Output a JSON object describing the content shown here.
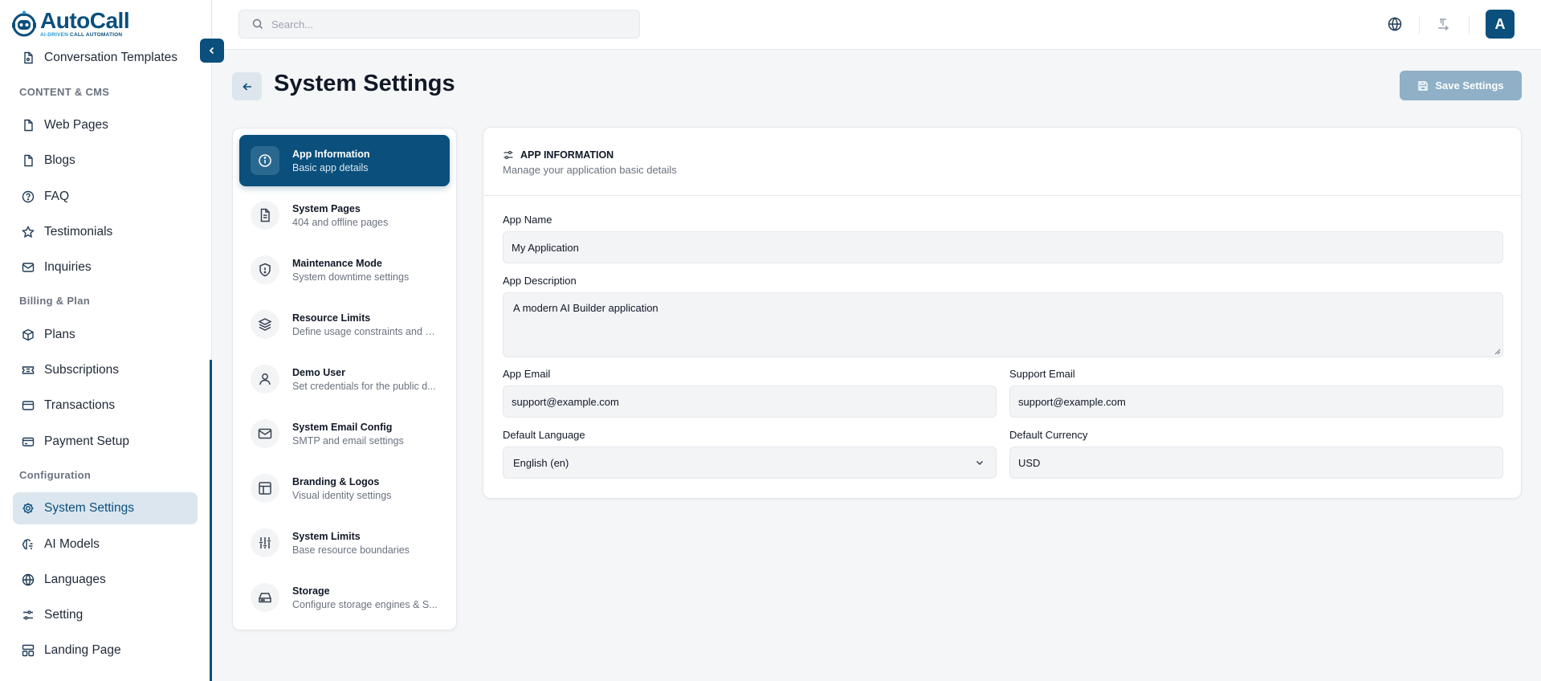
{
  "app": {
    "name": "AutoCall",
    "tagline_prefix": "AI-DRIVEN",
    "tagline_suffix": "CALL AUTOMATION"
  },
  "sidebar": {
    "items": [
      {
        "label": "Conversation Templates",
        "icon": "file-text-icon"
      },
      {
        "label": "Web Pages",
        "icon": "file-icon"
      },
      {
        "label": "Blogs",
        "icon": "file-icon"
      },
      {
        "label": "FAQ",
        "icon": "help-circle-icon"
      },
      {
        "label": "Testimonials",
        "icon": "star-icon"
      },
      {
        "label": "Inquiries",
        "icon": "mail-icon"
      },
      {
        "label": "Plans",
        "icon": "package-icon"
      },
      {
        "label": "Subscriptions",
        "icon": "ticket-icon"
      },
      {
        "label": "Transactions",
        "icon": "credit-card-icon"
      },
      {
        "label": "Payment Setup",
        "icon": "wallet-icon"
      },
      {
        "label": "System Settings",
        "icon": "gear-icon",
        "active": true
      },
      {
        "label": "AI Models",
        "icon": "brain-icon"
      },
      {
        "label": "Languages",
        "icon": "globe-icon"
      },
      {
        "label": "Setting",
        "icon": "sliders-icon"
      },
      {
        "label": "Landing Page",
        "icon": "layout-icon"
      }
    ],
    "sections": [
      "CONTENT & CMS",
      "Billing & Plan",
      "Configuration"
    ]
  },
  "topbar": {
    "search_placeholder": "Search...",
    "avatar_initial": "A"
  },
  "page": {
    "title": "System Settings",
    "save_label": "Save Settings"
  },
  "settings_menu": [
    {
      "title": "App Information",
      "subtitle": "Basic app details",
      "icon": "info-icon",
      "active": true
    },
    {
      "title": "System Pages",
      "subtitle": "404 and offline pages",
      "icon": "file-text-icon"
    },
    {
      "title": "Maintenance Mode",
      "subtitle": "System downtime settings",
      "icon": "shield-alert-icon"
    },
    {
      "title": "Resource Limits",
      "subtitle": "Define usage constraints and s...",
      "icon": "layers-icon"
    },
    {
      "title": "Demo User",
      "subtitle": "Set credentials for the public d...",
      "icon": "user-icon"
    },
    {
      "title": "System Email Config",
      "subtitle": "SMTP and email settings",
      "icon": "mail-icon"
    },
    {
      "title": "Branding & Logos",
      "subtitle": "Visual identity settings",
      "icon": "layout-icon"
    },
    {
      "title": "System Limits",
      "subtitle": "Base resource boundaries",
      "icon": "sliders-vertical-icon"
    },
    {
      "title": "Storage",
      "subtitle": "Configure storage engines & S...",
      "icon": "hard-drive-icon"
    }
  ],
  "form": {
    "title": "APP INFORMATION",
    "subtitle": "Manage your application basic details",
    "app_name_label": "App Name",
    "app_name_value": "My Application",
    "app_description_label": "App Description",
    "app_description_value": "A modern AI Builder application",
    "app_email_label": "App Email",
    "app_email_value": "support@example.com",
    "support_email_label": "Support Email",
    "support_email_value": "support@example.com",
    "default_language_label": "Default Language",
    "default_language_value": "English (en)",
    "default_currency_label": "Default Currency",
    "default_currency_value": "USD"
  },
  "colors": {
    "primary": "#0b4f7c",
    "active_nav_bg": "#dbe6ef",
    "save_button_disabled": "#8fb0c6"
  }
}
